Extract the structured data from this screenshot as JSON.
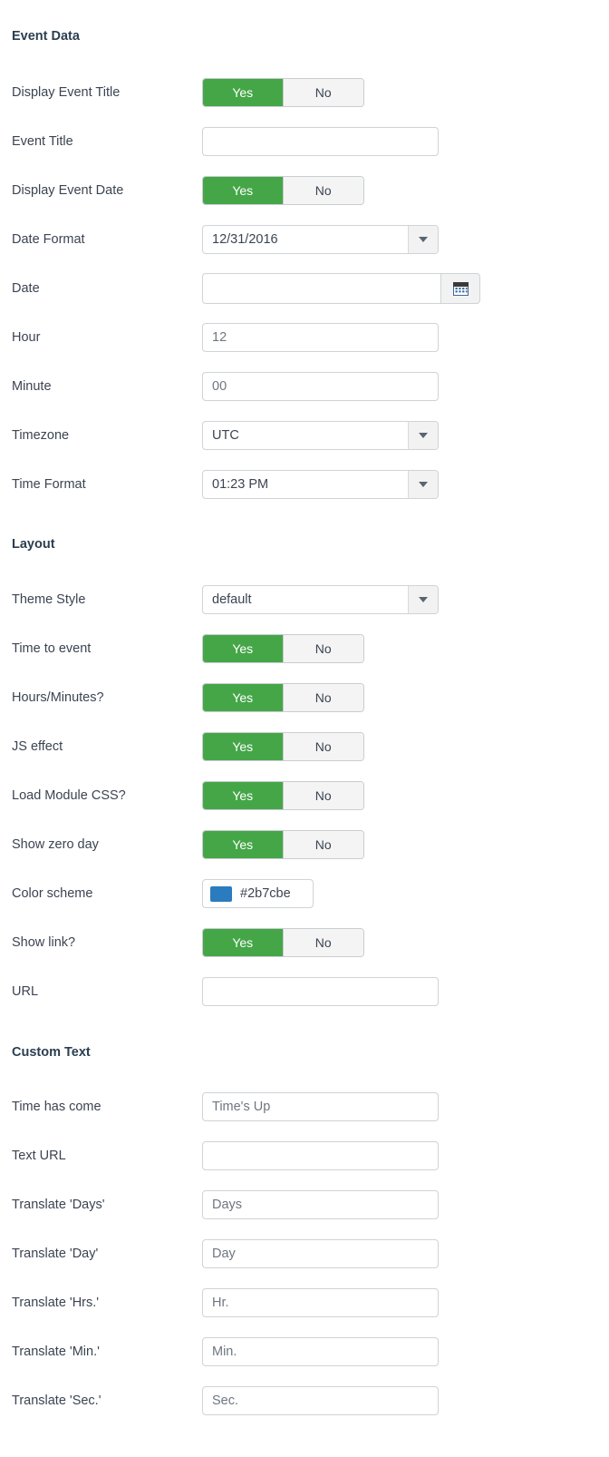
{
  "sections": {
    "event_data": {
      "title": "Event Data",
      "rows": {
        "display_event_title": {
          "label": "Display Event Title",
          "yes": "Yes",
          "no": "No",
          "value": "Yes"
        },
        "event_title": {
          "label": "Event Title",
          "value": ""
        },
        "display_event_date": {
          "label": "Display Event Date",
          "yes": "Yes",
          "no": "No",
          "value": "Yes"
        },
        "date_format": {
          "label": "Date Format",
          "value": "12/31/2016"
        },
        "date": {
          "label": "Date",
          "value": "",
          "button_icon": "calendar-icon"
        },
        "hour": {
          "label": "Hour",
          "value": "12"
        },
        "minute": {
          "label": "Minute",
          "value": "00"
        },
        "timezone": {
          "label": "Timezone",
          "value": "UTC"
        },
        "time_format": {
          "label": "Time Format",
          "value": "01:23 PM"
        }
      }
    },
    "layout": {
      "title": "Layout",
      "rows": {
        "theme_style": {
          "label": "Theme Style",
          "value": "default"
        },
        "time_to_event": {
          "label": "Time to event",
          "yes": "Yes",
          "no": "No",
          "value": "Yes"
        },
        "hours_minutes": {
          "label": "Hours/Minutes?",
          "yes": "Yes",
          "no": "No",
          "value": "Yes"
        },
        "js_effect": {
          "label": "JS effect",
          "yes": "Yes",
          "no": "No",
          "value": "Yes"
        },
        "load_module_css": {
          "label": "Load Module CSS?",
          "yes": "Yes",
          "no": "No",
          "value": "Yes"
        },
        "show_zero_day": {
          "label": "Show zero day",
          "yes": "Yes",
          "no": "No",
          "value": "Yes"
        },
        "color_scheme": {
          "label": "Color scheme",
          "value": "#2b7cbe",
          "swatch": "#2b7cbe"
        },
        "show_link": {
          "label": "Show link?",
          "yes": "Yes",
          "no": "No",
          "value": "Yes"
        },
        "url": {
          "label": "URL",
          "value": ""
        }
      }
    },
    "custom_text": {
      "title": "Custom Text",
      "rows": {
        "time_has_come": {
          "label": "Time has come",
          "value": "Time's Up"
        },
        "text_url": {
          "label": "Text URL",
          "value": ""
        },
        "translate_days": {
          "label": "Translate 'Days'",
          "value": "Days"
        },
        "translate_day": {
          "label": "Translate 'Day'",
          "value": "Day"
        },
        "translate_hrs": {
          "label": "Translate 'Hrs.'",
          "value": "Hr."
        },
        "translate_min": {
          "label": "Translate 'Min.'",
          "value": "Min."
        },
        "translate_sec": {
          "label": "Translate 'Sec.'",
          "value": "Sec."
        }
      }
    }
  },
  "colors": {
    "toggle_on": "#45a648",
    "accent": "#2b7cbe"
  }
}
